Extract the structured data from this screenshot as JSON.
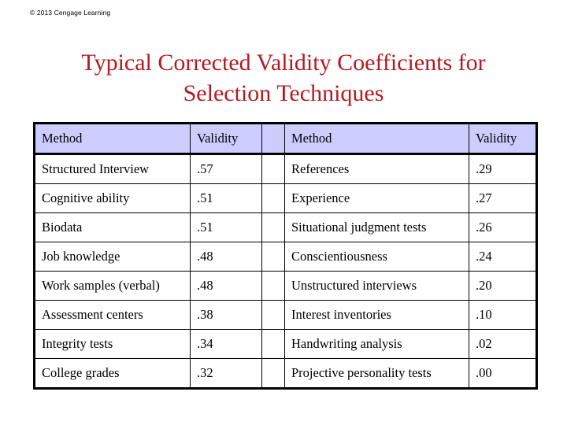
{
  "slide": {
    "copyright": "© 2013 Cengage Learning",
    "title": "Typical Corrected Validity Coefficients for\nSelection Techniques",
    "title_color": "#B51A22",
    "header_background": "#CCCCFF"
  },
  "table": {
    "headers": {
      "left_method": "Method",
      "left_validity": "Validity",
      "right_method": "Method",
      "right_validity": "Validity"
    },
    "rows": [
      {
        "left_method": "Structured Interview",
        "left_validity": ".57",
        "right_method": "References",
        "right_validity": ".29"
      },
      {
        "left_method": "Cognitive ability",
        "left_validity": ".51",
        "right_method": "Experience",
        "right_validity": ".27"
      },
      {
        "left_method": "Biodata",
        "left_validity": ".51",
        "right_method": "Situational judgment tests",
        "right_validity": ".26"
      },
      {
        "left_method": "Job knowledge",
        "left_validity": ".48",
        "right_method": "Conscientiousness",
        "right_validity": ".24"
      },
      {
        "left_method": "Work samples (verbal)",
        "left_validity": ".48",
        "right_method": "Unstructured interviews",
        "right_validity": ".20"
      },
      {
        "left_method": "Assessment centers",
        "left_validity": ".38",
        "right_method": "Interest inventories",
        "right_validity": ".10"
      },
      {
        "left_method": "Integrity tests",
        "left_validity": ".34",
        "right_method": "Handwriting analysis",
        "right_validity": ".02"
      },
      {
        "left_method": "College grades",
        "left_validity": ".32",
        "right_method": "Projective personality tests",
        "right_validity": ".00"
      }
    ]
  }
}
